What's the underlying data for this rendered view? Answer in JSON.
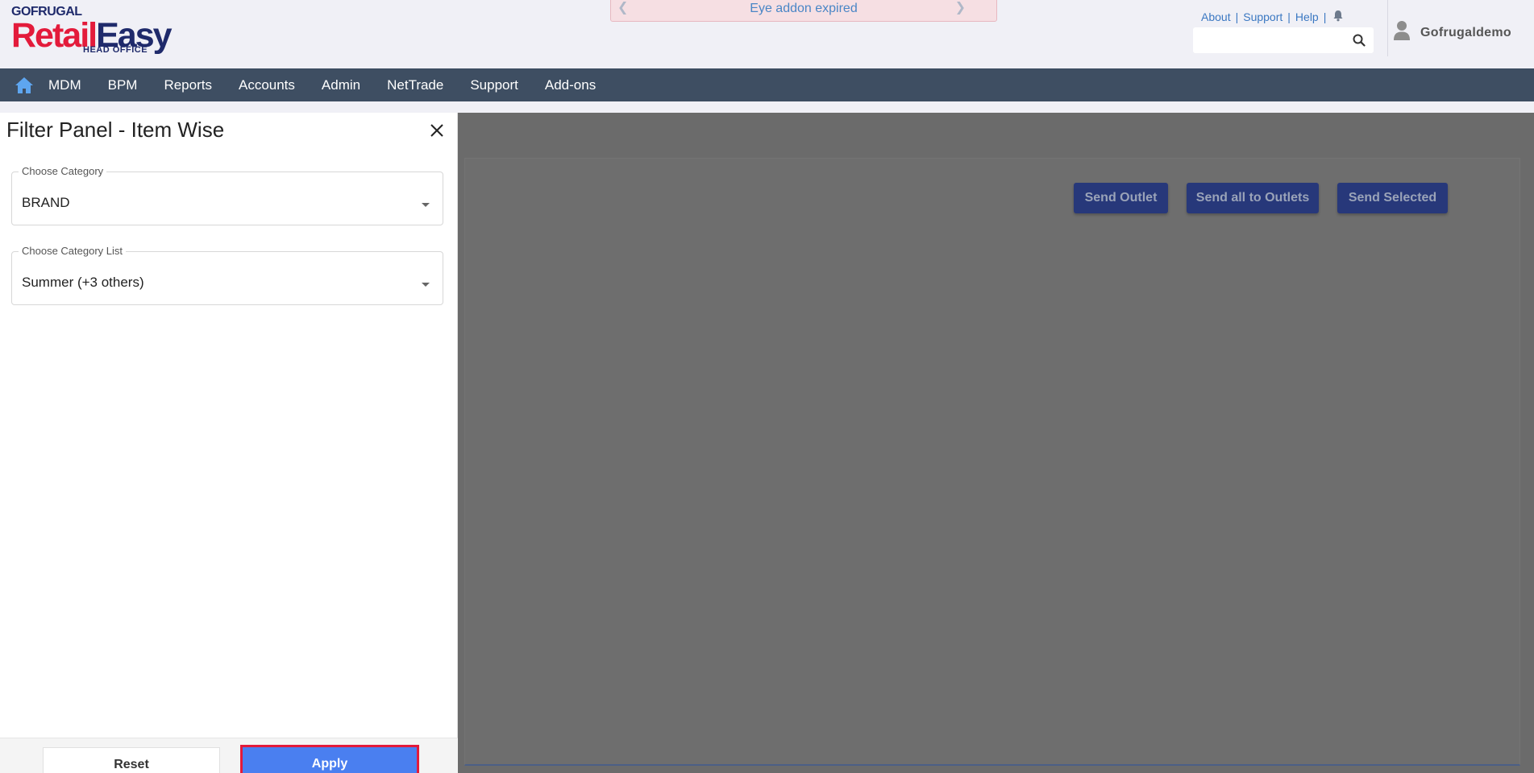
{
  "header": {
    "logo": {
      "top": "GOFRUGAL",
      "main_red": "Retail",
      "main_blue": "Easy",
      "sub": "HEAD OFFICE"
    },
    "notice": "Eye addon expired",
    "links": [
      "About",
      "Support",
      "Help"
    ],
    "search": {
      "placeholder": "",
      "value": ""
    },
    "user": "Gofrugaldemo"
  },
  "nav": {
    "items": [
      "MDM",
      "BPM",
      "Reports",
      "Accounts",
      "Admin",
      "NetTrade",
      "Support",
      "Add-ons"
    ]
  },
  "main": {
    "buttons": [
      "Send Outlet",
      "Send all to Outlets",
      "Send Selected"
    ]
  },
  "panel": {
    "title": "Filter Panel - Item Wise",
    "fields": [
      {
        "label": "Choose Category",
        "value": "BRAND"
      },
      {
        "label": "Choose Category List",
        "value": "Summer (+3 others)"
      }
    ],
    "reset_label": "Reset",
    "apply_label": "Apply"
  },
  "colors": {
    "nav_bg": "#3e4e62",
    "brand_red": "#e31b3b",
    "brand_blue": "#1f2a6b",
    "apply_bg": "#4a7ff0",
    "highlight_border": "#e21a3b",
    "overlay": "#6b6b6b"
  }
}
